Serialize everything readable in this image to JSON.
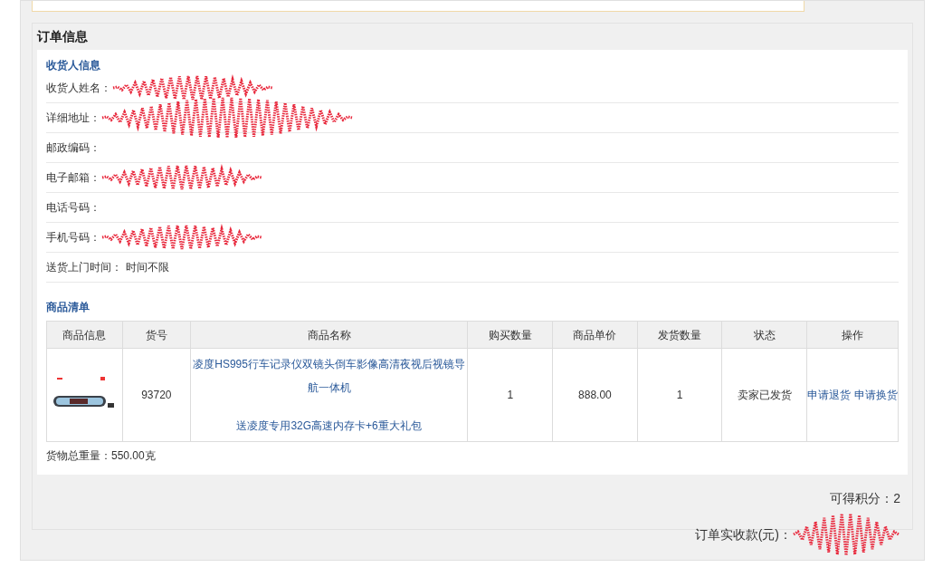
{
  "section_title": "订单信息",
  "consignee": {
    "title": "收货人信息",
    "fields": [
      {
        "label": "收货人姓名：",
        "redacted": true
      },
      {
        "label": "详细地址：",
        "redacted": true
      },
      {
        "label": "邮政编码：",
        "redacted": false
      },
      {
        "label": "电子邮箱：",
        "redacted": true
      },
      {
        "label": "电话号码：",
        "redacted": false
      },
      {
        "label": "手机号码：",
        "redacted": true
      },
      {
        "label": "送货上门时间：",
        "value": "时间不限",
        "redacted": false
      }
    ]
  },
  "goods": {
    "title": "商品清单",
    "columns": [
      "商品信息",
      "货号",
      "商品名称",
      "购买数量",
      "商品单价",
      "发货数量",
      "状态",
      "操作"
    ],
    "rows": [
      {
        "sku": "93720",
        "name": "凌度HS995行车记录仪双镜头倒车影像高清夜视后视镜导航一体机",
        "gift": "送凌度专用32G高速内存卡+6重大礼包",
        "quantity": "1",
        "price": "888.00",
        "shipped": "1",
        "status": "卖家已发货",
        "actions": [
          "申请退货",
          "申请换货"
        ]
      }
    ],
    "total_weight": "货物总重量：550.00克"
  },
  "summary": {
    "points": "可得积分：2",
    "amount_label": "订单实收款(元)：",
    "amount_redacted": true
  }
}
